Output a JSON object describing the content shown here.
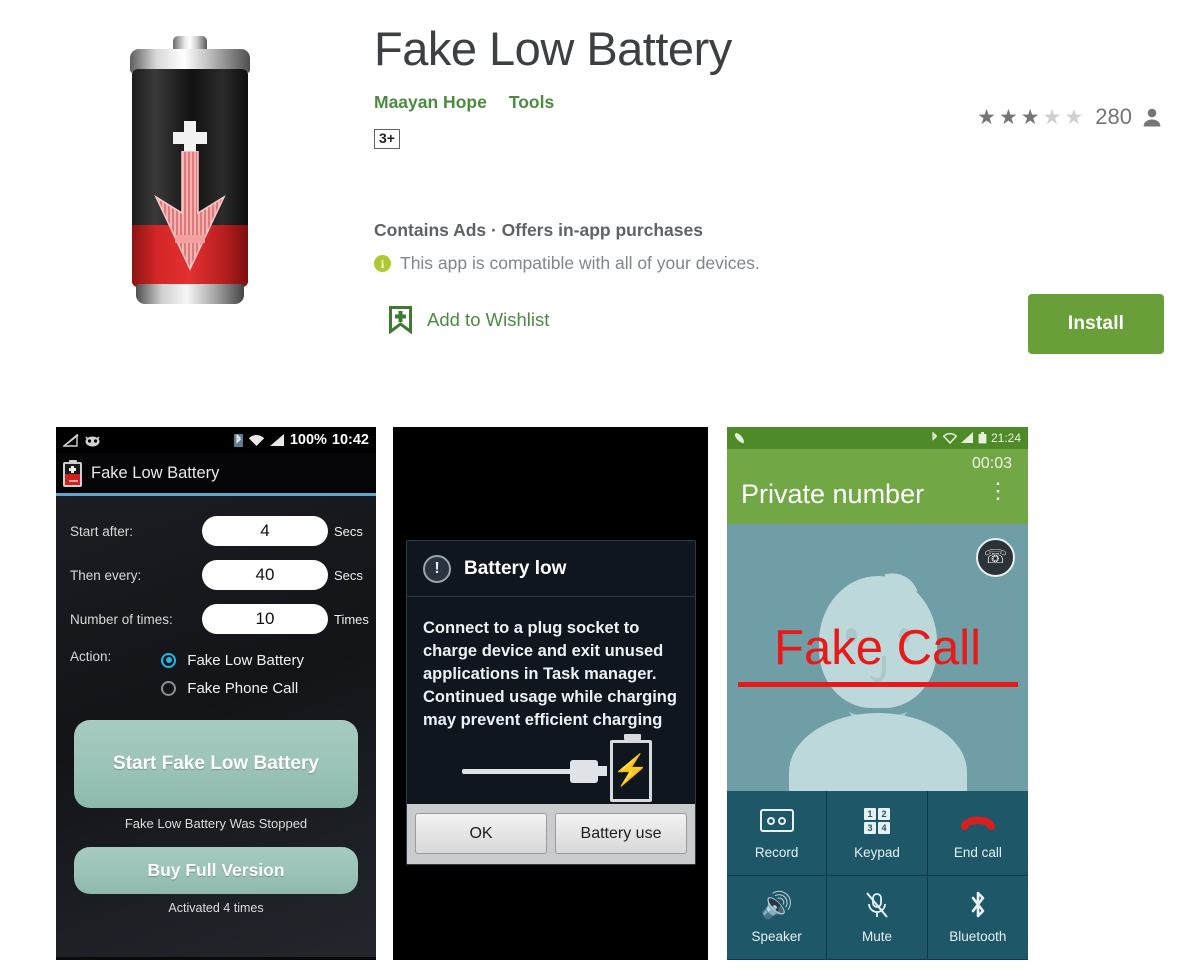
{
  "app": {
    "title": "Fake Low Battery",
    "developer": "Maayan Hope",
    "category": "Tools",
    "age_rating": "3+",
    "monetization": "Contains Ads · Offers in-app purchases",
    "compatibility": "This app is compatible with all of your devices.",
    "wishlist_label": "Add to Wishlist",
    "install_label": "Install",
    "icon_name": "battery-low-app-icon"
  },
  "rating": {
    "stars_filled": 3,
    "stars_total": 5,
    "count": "280",
    "star_glyph": "★",
    "person_glyph": "\u0000"
  },
  "colors": {
    "brand_green": "#4c8b3f",
    "install_green": "#689f38",
    "info_badge": "#aec92b",
    "accent_blue": "#5fa8cc",
    "radio_on": "#21b7e8",
    "call_green": "#72a745",
    "call_teal": "#1d5768",
    "alert_red": "#e81919"
  },
  "screenshots": [
    {
      "name": "app-settings-screen",
      "status_bar": {
        "signal_off_icon": "◤",
        "mascot_icon": "●",
        "bluetooth": "ᛗ",
        "wifi": "◠",
        "signal": "◥",
        "battery_percent": "100%",
        "time": "10:42"
      },
      "app_bar_title": "Fake Low Battery",
      "fields": [
        {
          "label": "Start after:",
          "value": "4",
          "unit": "Secs"
        },
        {
          "label": "Then every:",
          "value": "40",
          "unit": "Secs"
        },
        {
          "label": "Number of times:",
          "value": "10",
          "unit": "Times"
        }
      ],
      "action_label": "Action:",
      "radio_options": [
        {
          "label": "Fake Low Battery",
          "selected": true
        },
        {
          "label": "Fake Phone Call",
          "selected": false
        }
      ],
      "start_button": "Start Fake Low Battery",
      "start_status": "Fake Low Battery Was Stopped",
      "buy_button": "Buy Full Version",
      "buy_status": "Activated 4 times"
    },
    {
      "name": "battery-low-dialog-screen",
      "dialog_title": "Battery low",
      "dialog_body": "Connect to a plug socket to charge device and exit unused applications in Task manager. Continued usage while charging may prevent efficient charging",
      "buttons": [
        "OK",
        "Battery use"
      ],
      "graphic": "usb-cable-charging-battery"
    },
    {
      "name": "fake-call-screen",
      "status_bar": {
        "phone_icon": "✆",
        "bluetooth": "ᛗ",
        "wifi": "◠",
        "signal": "◥",
        "battery": "▮",
        "time": "21:24"
      },
      "call_timer": "00:03",
      "caller_name": "Private number",
      "overflow_icon": "⋮",
      "overlay_text": "Fake Call",
      "call_buttons": [
        {
          "label": "Record",
          "icon": "record-icon"
        },
        {
          "label": "Keypad",
          "icon": "keypad-icon"
        },
        {
          "label": "End call",
          "icon": "end-call-icon"
        },
        {
          "label": "Speaker",
          "icon": "speaker-icon"
        },
        {
          "label": "Mute",
          "icon": "mute-icon"
        },
        {
          "label": "Bluetooth",
          "icon": "bluetooth-icon"
        }
      ],
      "keypad_digits": [
        "1",
        "2",
        "3",
        "4"
      ]
    }
  ]
}
